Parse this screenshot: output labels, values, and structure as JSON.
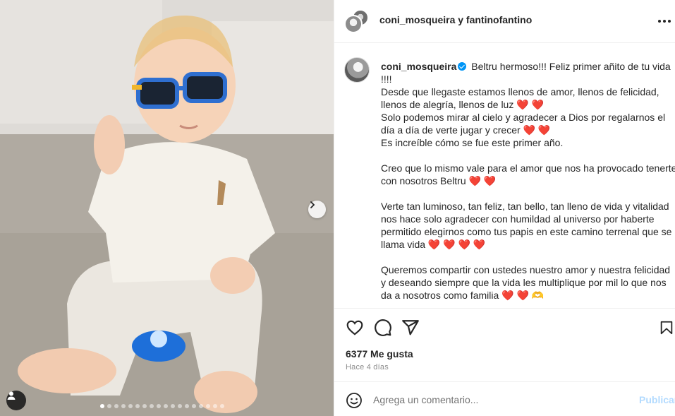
{
  "header": {
    "title": "coni_mosqueira y fantinofantino",
    "more_icon": "more-horizontal-icon"
  },
  "photo": {
    "carousel_dot_count": 18,
    "active_dot_index": 0,
    "next_icon": "chevron-right-icon",
    "tag_icon": "user-tag-icon"
  },
  "caption": {
    "username": "coni_mosqueira",
    "verified": true,
    "text": " Beltru hermoso!!! Feliz primer añito de tu vida !!!!\nDesde que llegaste estamos llenos de amor, llenos de felicidad, llenos de alegría, llenos de luz ❤️ ❤️\nSolo podemos mirar al cielo y agradecer a Dios por regalarnos el día a día de verte jugar y crecer ❤️ ❤️\nEs increíble cómo se fue este primer año.\n\nCreo que lo mismo vale para el amor que nos ha provocado tenerte con nosotros Beltru ❤️ ❤️\n\nVerte tan luminoso, tan feliz, tan bello, tan lleno de vida y vitalidad nos hace solo agradecer con humildad al universo por haberte permitido elegirnos como tus papis en este camino terrenal que se llama vida ❤️ ❤️ ❤️ ❤️\n\nQueremos compartir con ustedes nuestro amor y nuestra felicidad y deseando siempre que la vida les multiplique por mil lo que nos da a nosotros como familia ❤️ ❤️ 🫶"
  },
  "actions": {
    "like_icon": "heart-icon",
    "comment_icon": "comment-icon",
    "share_icon": "share-icon",
    "save_icon": "bookmark-icon",
    "likes_text": "6377 Me gusta",
    "date_text": "Hace 4 días"
  },
  "comment": {
    "emoji_icon": "emoji-icon",
    "placeholder": "Agrega un comentario...",
    "value": "",
    "publish_label": "Publicar",
    "publish_color": "#b3dbff"
  },
  "colors": {
    "verified": "#0095f6",
    "text": "#262626",
    "muted": "#8e8e8e",
    "heart": "#e0245e",
    "glasses_frame": "#2f6fd0"
  }
}
